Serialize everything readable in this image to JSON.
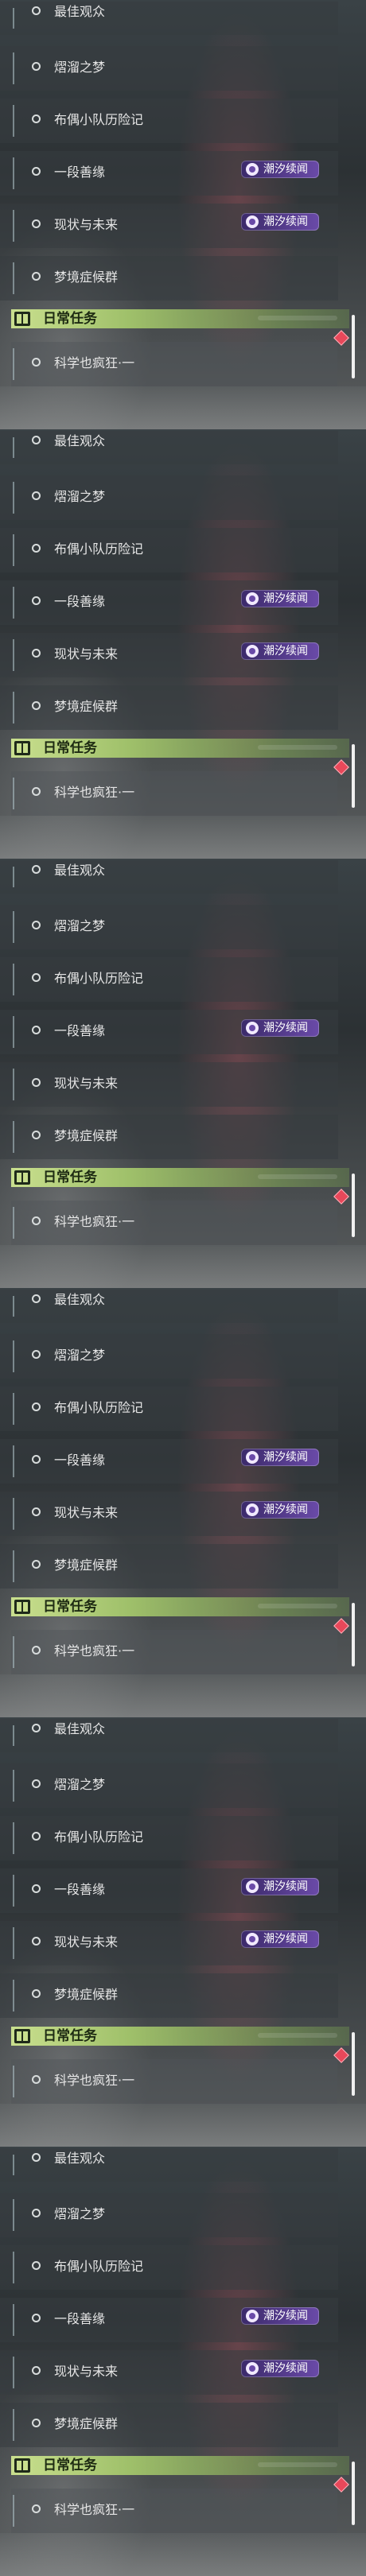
{
  "panels": [
    {
      "quests": [
        {
          "label": "最佳观众",
          "tag": ""
        },
        {
          "label": "熠溜之梦",
          "tag": ""
        },
        {
          "label": "布偶小队历险记",
          "tag": ""
        },
        {
          "label": "一段善缘",
          "tag": "潮汐续闻"
        },
        {
          "label": "现状与未来",
          "tag": "潮汐续闻"
        },
        {
          "label": "梦境症候群",
          "tag": ""
        }
      ],
      "section_title": "日常任务",
      "daily_quest": "科学也疯狂·一"
    },
    {
      "quests": [
        {
          "label": "最佳观众",
          "tag": ""
        },
        {
          "label": "熠溜之梦",
          "tag": ""
        },
        {
          "label": "布偶小队历险记",
          "tag": ""
        },
        {
          "label": "一段善缘",
          "tag": "潮汐续闻"
        },
        {
          "label": "现状与未来",
          "tag": "潮汐续闻"
        },
        {
          "label": "梦境症候群",
          "tag": ""
        }
      ],
      "section_title": "日常任务",
      "daily_quest": "科学也疯狂·一"
    },
    {
      "quests": [
        {
          "label": "最佳观众",
          "tag": ""
        },
        {
          "label": "熠溜之梦",
          "tag": ""
        },
        {
          "label": "布偶小队历险记",
          "tag": ""
        },
        {
          "label": "一段善缘",
          "tag": "潮汐续闻"
        },
        {
          "label": "现状与未来",
          "tag": ""
        },
        {
          "label": "梦境症候群",
          "tag": ""
        }
      ],
      "section_title": "日常任务",
      "daily_quest": "科学也疯狂·一"
    },
    {
      "quests": [
        {
          "label": "最佳观众",
          "tag": ""
        },
        {
          "label": "熠溜之梦",
          "tag": ""
        },
        {
          "label": "布偶小队历险记",
          "tag": ""
        },
        {
          "label": "一段善缘",
          "tag": "潮汐续闻"
        },
        {
          "label": "现状与未来",
          "tag": "潮汐续闻"
        },
        {
          "label": "梦境症候群",
          "tag": ""
        }
      ],
      "section_title": "日常任务",
      "daily_quest": "科学也疯狂·一"
    },
    {
      "quests": [
        {
          "label": "最佳观众",
          "tag": ""
        },
        {
          "label": "熠溜之梦",
          "tag": ""
        },
        {
          "label": "布偶小队历险记",
          "tag": ""
        },
        {
          "label": "一段善缘",
          "tag": "潮汐续闻"
        },
        {
          "label": "现状与未来",
          "tag": "潮汐续闻"
        },
        {
          "label": "梦境症候群",
          "tag": ""
        }
      ],
      "section_title": "日常任务",
      "daily_quest": "科学也疯狂·一"
    },
    {
      "quests": [
        {
          "label": "最佳观众",
          "tag": ""
        },
        {
          "label": "熠溜之梦",
          "tag": ""
        },
        {
          "label": "布偶小队历险记",
          "tag": ""
        },
        {
          "label": "一段善缘",
          "tag": "潮汐续闻"
        },
        {
          "label": "现状与未来",
          "tag": "潮汐续闻"
        },
        {
          "label": "梦境症候群",
          "tag": ""
        }
      ],
      "section_title": "日常任务",
      "daily_quest": "科学也疯狂·一"
    }
  ],
  "icons": {
    "radio": "radio-circle-icon",
    "section": "book-icon",
    "alert": "red-diamond-icon",
    "tag": "tide-tag-icon"
  },
  "colors": {
    "section_header": "#c9df8e",
    "tag": "#6a4aa8",
    "alert": "#e8485a"
  }
}
